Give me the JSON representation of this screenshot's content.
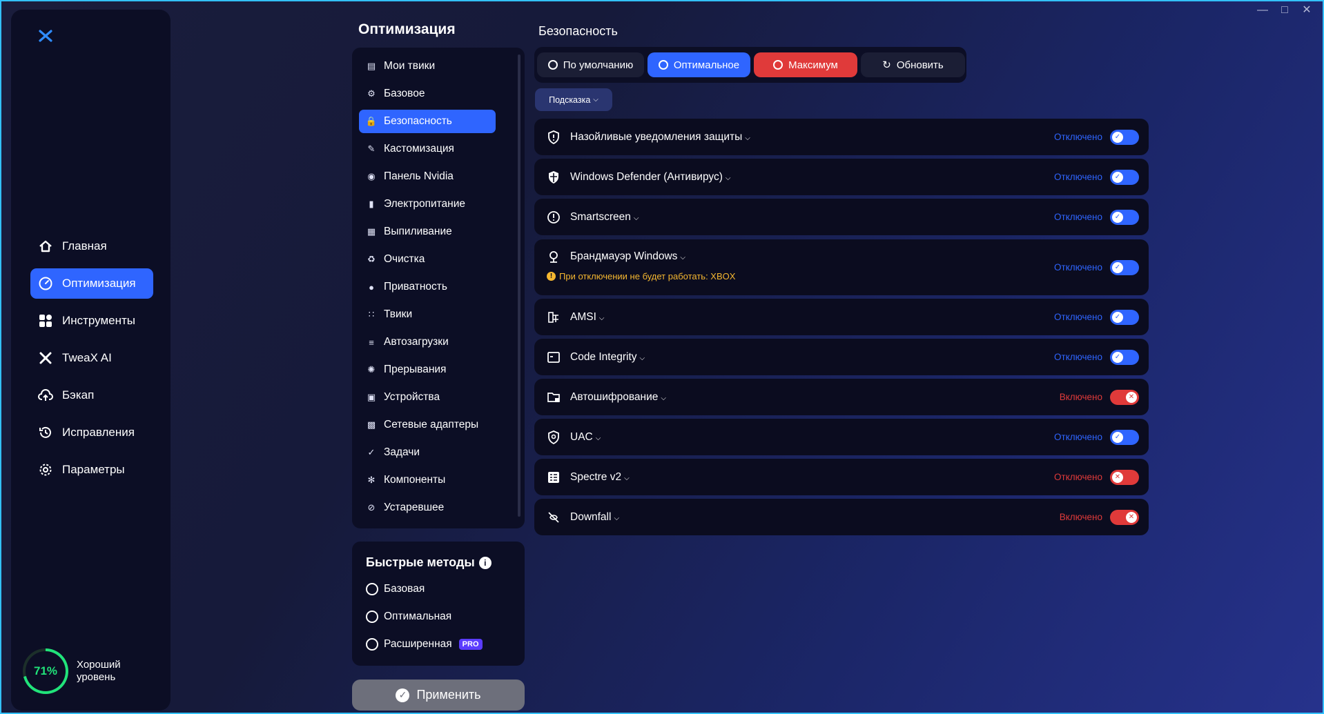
{
  "window": {
    "minimize_icon": "minimize-icon",
    "maximize_icon": "maximize-icon",
    "close_icon": "close-icon"
  },
  "sidebar": {
    "logo": "tweax-logo",
    "items": [
      {
        "label": "Главная",
        "icon": "home-icon",
        "active": false
      },
      {
        "label": "Оптимизация",
        "icon": "speedometer-icon",
        "active": true
      },
      {
        "label": "Инструменты",
        "icon": "grid-icon",
        "active": false
      },
      {
        "label": "TweaX AI",
        "icon": "ai-icon",
        "active": false
      },
      {
        "label": "Бэкап",
        "icon": "cloud-upload-icon",
        "active": false
      },
      {
        "label": "Исправления",
        "icon": "history-icon",
        "active": false
      },
      {
        "label": "Параметры",
        "icon": "gear-icon",
        "active": false
      }
    ],
    "score": {
      "percent": "71%",
      "label": "Хороший уровень",
      "value": 0.71,
      "color": "#21e37a"
    }
  },
  "optimization": {
    "title": "Оптимизация",
    "categories": [
      {
        "label": "Мои твики",
        "icon": "my-tweaks-icon",
        "active": false
      },
      {
        "label": "Базовое",
        "icon": "basic-icon",
        "active": false
      },
      {
        "label": "Безопасность",
        "icon": "lock-icon",
        "active": true
      },
      {
        "label": "Кастомизация",
        "icon": "brush-icon",
        "active": false
      },
      {
        "label": "Панель Nvidia",
        "icon": "nvidia-icon",
        "active": false
      },
      {
        "label": "Электропитание",
        "icon": "battery-icon",
        "active": false
      },
      {
        "label": "Выпиливание",
        "icon": "windows-icon",
        "active": false
      },
      {
        "label": "Очистка",
        "icon": "broom-icon",
        "active": false
      },
      {
        "label": "Приватность",
        "icon": "privacy-icon",
        "active": false
      },
      {
        "label": "Твики",
        "icon": "tweaks-grid-icon",
        "active": false
      },
      {
        "label": "Автозагрузки",
        "icon": "autostart-icon",
        "active": false
      },
      {
        "label": "Прерывания",
        "icon": "interrupt-icon",
        "active": false
      },
      {
        "label": "Устройства",
        "icon": "chip-icon",
        "active": false
      },
      {
        "label": "Сетевые адаптеры",
        "icon": "network-icon",
        "active": false
      },
      {
        "label": "Задачи",
        "icon": "tasks-icon",
        "active": false
      },
      {
        "label": "Компоненты",
        "icon": "components-icon",
        "active": false
      },
      {
        "label": "Устаревшее",
        "icon": "deprecated-icon",
        "active": false
      }
    ],
    "quick": {
      "title": "Быстрые методы",
      "items": [
        {
          "label": "Базовая"
        },
        {
          "label": "Оптимальная"
        },
        {
          "label": "Расширенная",
          "badge": "PRO"
        }
      ]
    },
    "apply_label": "Применить"
  },
  "security": {
    "title": "Безопасность",
    "presets": [
      {
        "label": "По умолчанию",
        "style": "default"
      },
      {
        "label": "Оптимальное",
        "style": "optimal"
      },
      {
        "label": "Максимум",
        "style": "max"
      },
      {
        "label": "Обновить",
        "style": "refresh"
      }
    ],
    "hint_label": "Подсказка",
    "tweaks": [
      {
        "name": "Назойливые уведомления защиты",
        "icon": "shield-alert-icon",
        "status": "Отключено",
        "state": "off",
        "color": "blue"
      },
      {
        "name": "Windows Defender (Антивирус)",
        "icon": "defender-shield-icon",
        "status": "Отключено",
        "state": "off",
        "color": "blue"
      },
      {
        "name": "Smartscreen",
        "icon": "alert-circle-icon",
        "status": "Отключено",
        "state": "off",
        "color": "blue"
      },
      {
        "name": "Брандмауэр Windows",
        "icon": "firewall-icon",
        "status": "Отключено",
        "state": "off",
        "color": "blue",
        "warning": "При отключении не будет работать: XBOX"
      },
      {
        "name": "AMSI",
        "icon": "amsi-icon",
        "status": "Отключено",
        "state": "off",
        "color": "blue"
      },
      {
        "name": "Code Integrity",
        "icon": "window-icon",
        "status": "Отключено",
        "state": "off",
        "color": "blue"
      },
      {
        "name": "Автошифрование",
        "icon": "folder-lock-icon",
        "status": "Включено",
        "state": "on",
        "color": "red"
      },
      {
        "name": "UAC",
        "icon": "uac-shield-icon",
        "status": "Отключено",
        "state": "off",
        "color": "blue"
      },
      {
        "name": "Spectre v2",
        "icon": "spectre-icon",
        "status": "Отключено",
        "state": "off",
        "color": "red"
      },
      {
        "name": "Downfall",
        "icon": "downfall-icon",
        "status": "Включено",
        "state": "on",
        "color": "red"
      }
    ]
  }
}
